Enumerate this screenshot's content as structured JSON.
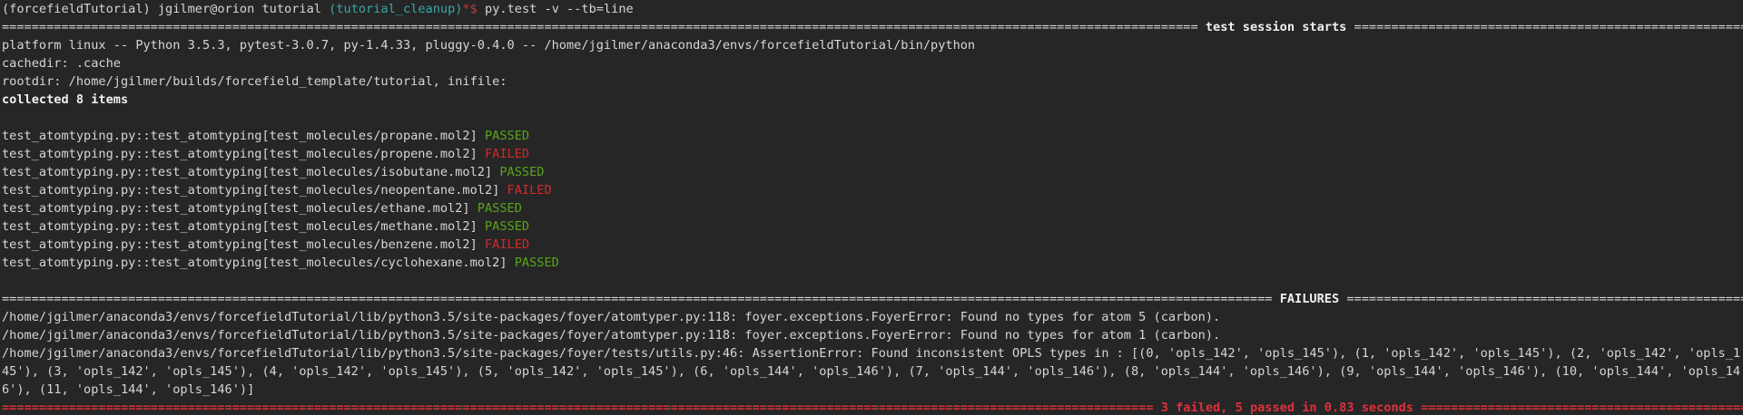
{
  "prompt": {
    "env": "(forcefieldTutorial)",
    "user_host": "jgilmer@orion",
    "cwd": "tutorial",
    "branch": "(tutorial_cleanup)",
    "symbol": "*$",
    "command": "py.test -v --tb=line"
  },
  "session_header": {
    "rule_left": "=================================================================================================================================================================",
    "title": "test session starts",
    "rule_right": "============================================================================================================================================================================"
  },
  "info_lines": [
    "platform linux -- Python 3.5.3, pytest-3.0.7, py-1.4.33, pluggy-0.4.0 -- /home/jgilmer/anaconda3/envs/forcefieldTutorial/bin/python",
    "cachedir: .cache",
    "rootdir: /home/jgilmer/builds/forcefield_template/tutorial, inifile:"
  ],
  "collected": "collected 8 items",
  "tests": [
    {
      "name": "test_atomtyping.py::test_atomtyping[test_molecules/propane.mol2]",
      "status": "PASSED"
    },
    {
      "name": "test_atomtyping.py::test_atomtyping[test_molecules/propene.mol2]",
      "status": "FAILED"
    },
    {
      "name": "test_atomtyping.py::test_atomtyping[test_molecules/isobutane.mol2]",
      "status": "PASSED"
    },
    {
      "name": "test_atomtyping.py::test_atomtyping[test_molecules/neopentane.mol2]",
      "status": "FAILED"
    },
    {
      "name": "test_atomtyping.py::test_atomtyping[test_molecules/ethane.mol2]",
      "status": "PASSED"
    },
    {
      "name": "test_atomtyping.py::test_atomtyping[test_molecules/methane.mol2]",
      "status": "PASSED"
    },
    {
      "name": "test_atomtyping.py::test_atomtyping[test_molecules/benzene.mol2]",
      "status": "FAILED"
    },
    {
      "name": "test_atomtyping.py::test_atomtyping[test_molecules/cyclohexane.mol2]",
      "status": "PASSED"
    }
  ],
  "failures_header": {
    "rule_left": "===========================================================================================================================================================================",
    "title": "FAILURES",
    "rule_right": "===================================================================================================================================================================================="
  },
  "failure_lines": [
    "/home/jgilmer/anaconda3/envs/forcefieldTutorial/lib/python3.5/site-packages/foyer/atomtyper.py:118: foyer.exceptions.FoyerError: Found no types for atom 5 (carbon).",
    "/home/jgilmer/anaconda3/envs/forcefieldTutorial/lib/python3.5/site-packages/foyer/atomtyper.py:118: foyer.exceptions.FoyerError: Found no types for atom 1 (carbon).",
    "/home/jgilmer/anaconda3/envs/forcefieldTutorial/lib/python3.5/site-packages/foyer/tests/utils.py:46: AssertionError: Found inconsistent OPLS types in : [(0, 'opls_142', 'opls_145'), (1, 'opls_142', 'opls_145'), (2, 'opls_142', 'opls_145'), (3, 'opls_142', 'opls_145'), (4, 'opls_142', 'opls_145'), (5, 'opls_142', 'opls_145'), (6, 'opls_144', 'opls_146'), (7, 'opls_144', 'opls_146'), (8, 'opls_144', 'opls_146'), (9, 'opls_144', 'opls_146'), (10, 'opls_144', 'opls_146'), (11, 'opls_144', 'opls_146')]"
  ],
  "summary": {
    "rule_left": "===========================================================================================================================================================",
    "text": "3 failed, 5 passed in 0.83 seconds",
    "rule_right": "==========================================================================================================================================================================="
  },
  "colors": {
    "background": "#262626",
    "foreground": "#d6d6d6",
    "passed": "#58a51b",
    "failed": "#d12a2a",
    "branch": "#3aa7a7"
  }
}
